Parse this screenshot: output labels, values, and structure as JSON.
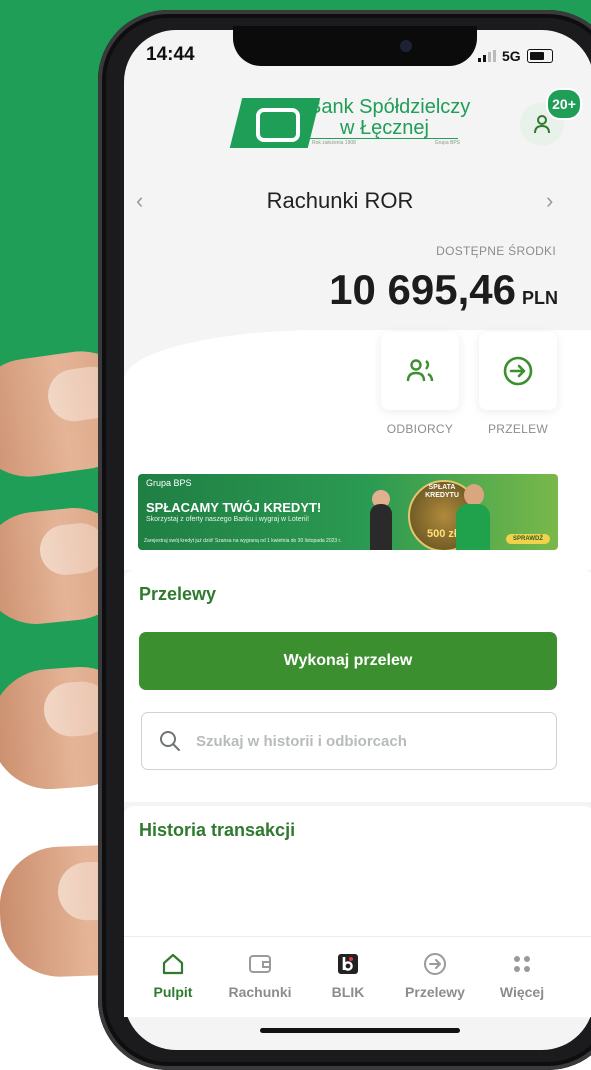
{
  "status_bar": {
    "time": "14:44",
    "network": "5G"
  },
  "header": {
    "logo_name_line1": "Bank Spółdzielczy",
    "logo_name_line2": "w Łęcznej",
    "logo_tag_left": "Rok założenia 1908",
    "logo_tag_right": "Grupa BPS",
    "notification_count": "20+"
  },
  "account": {
    "title": "Rachunki ROR",
    "available_label": "DOSTĘPNE ŚRODKI",
    "balance": "10 695,46",
    "currency": "PLN"
  },
  "quick_actions": [
    {
      "label": "ODBIORCY",
      "icon": "recipients-icon"
    },
    {
      "label": "PRZELEW",
      "icon": "arrow-right-circle-icon"
    }
  ],
  "banner": {
    "brand": "Grupa BPS",
    "title": "SPŁACAMY TWÓJ KREDYT!",
    "subtitle": "Skorzystaj z oferty naszego Banku i wygraj w Loterii!",
    "footnote": "Zarejestruj swój kredyt już dziś! Szansa na wygraną od 1 kwietnia do 30 listopada 2023 r.",
    "coin_text": "SPŁATA KREDYTU",
    "coin_amount": "500 zł",
    "cta": "SPRAWDŹ"
  },
  "transfers": {
    "title": "Przelewy",
    "primary_button": "Wykonaj przelew",
    "search_placeholder": "Szukaj w historii i odbiorcach"
  },
  "history": {
    "title": "Historia transakcji"
  },
  "tabs": [
    {
      "label": "Pulpit",
      "icon": "home-icon",
      "active": true
    },
    {
      "label": "Rachunki",
      "icon": "wallet-icon",
      "active": false
    },
    {
      "label": "BLIK",
      "icon": "blik-icon",
      "active": false
    },
    {
      "label": "Przelewy",
      "icon": "transfer-icon",
      "active": false
    },
    {
      "label": "Więcej",
      "icon": "more-icon",
      "active": false
    }
  ],
  "colors": {
    "brand_green": "#1f9e57",
    "button_green": "#3c8f2f",
    "title_green": "#2f7a2f",
    "muted_text": "#8c8c8c"
  }
}
